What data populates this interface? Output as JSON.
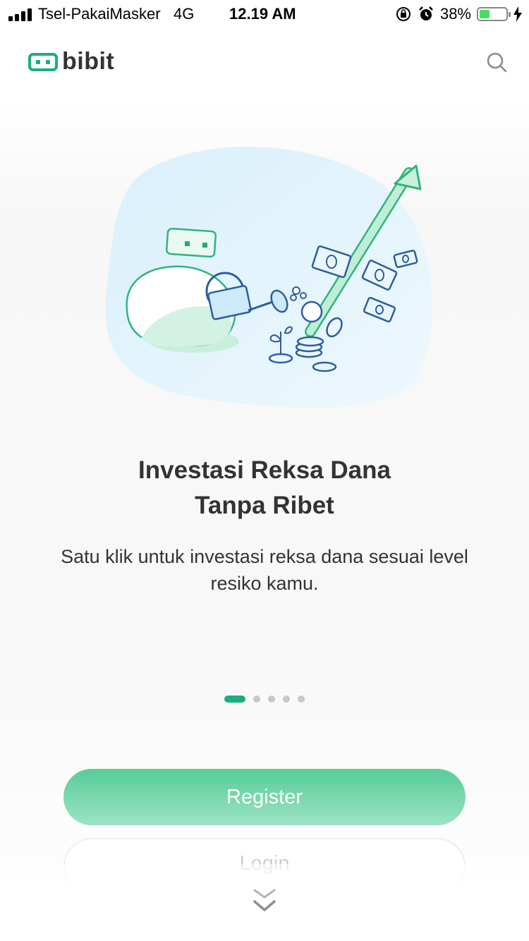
{
  "status_bar": {
    "carrier": "Tsel-PakaiMasker",
    "network": "4G",
    "time": "12.19 AM",
    "battery_percent": "38%",
    "battery_level": 0.38,
    "icons": [
      "signal-icon",
      "orientation-lock-icon",
      "alarm-icon",
      "battery-icon",
      "charging-icon"
    ]
  },
  "header": {
    "logo_text": "bibit",
    "search_icon": "search-icon",
    "brand_color": "#1aaf7b"
  },
  "onboarding": {
    "title_line1": "Investasi Reksa Dana",
    "title_line2": "Tanpa Ribet",
    "subtitle": "Satu klik untuk investasi reksa dana sesuai level resiko kamu.",
    "page_count": 5,
    "active_page": 1
  },
  "actions": {
    "register_label": "Register",
    "login_label": "Login",
    "scroll_hint_icon": "double-chevron-down-icon"
  }
}
